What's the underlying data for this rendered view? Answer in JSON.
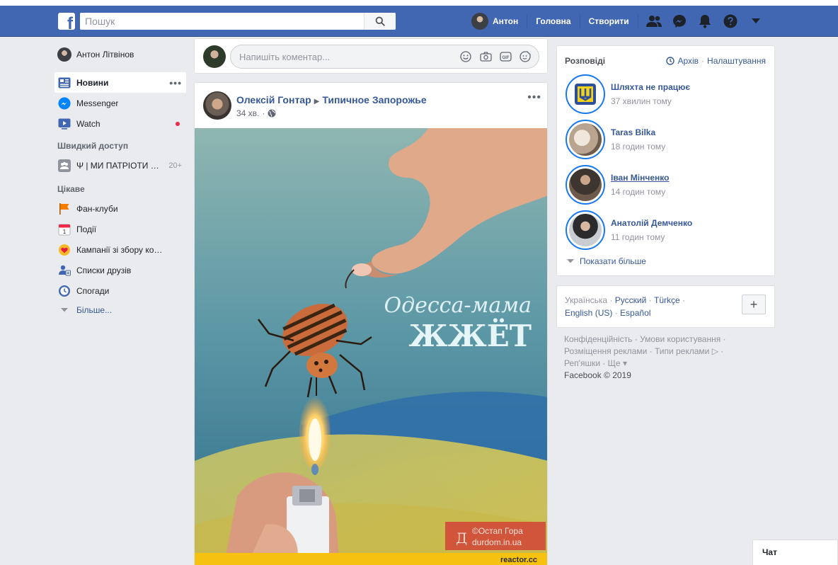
{
  "topbar": {
    "logo_letter": "f",
    "search_placeholder": "Пошук",
    "user_name": "Антон",
    "home_label": "Головна",
    "create_label": "Створити",
    "icons": [
      "friends-icon",
      "messenger-icon",
      "bell-icon",
      "help-icon",
      "caret-down-icon"
    ]
  },
  "sidebar": {
    "profile_name": "Антон Літвінов",
    "main_items": [
      {
        "label": "Новини",
        "icon": "news-feed-icon"
      },
      {
        "label": "Messenger",
        "icon": "messenger-icon"
      },
      {
        "label": "Watch",
        "icon": "watch-icon"
      }
    ],
    "quick_access_title": "Швидкий доступ",
    "quick_access_item": {
      "label": "Ψ | МИ ПАТРІОТИ УКРАЇНИ",
      "count": "20+"
    },
    "explore_title": "Цікаве",
    "explore_items": [
      {
        "label": "Фан-клуби",
        "icon": "flag-icon"
      },
      {
        "label": "Події",
        "icon": "calendar-icon"
      },
      {
        "label": "Кампанії зі збору коштів",
        "icon": "fundraiser-icon"
      },
      {
        "label": "Списки друзів",
        "icon": "friend-lists-icon"
      },
      {
        "label": "Спогади",
        "icon": "memories-icon"
      }
    ],
    "more_label": "Більше..."
  },
  "composer": {
    "placeholder": "Напишіть коментар..."
  },
  "post": {
    "author": "Олексій Гонтар",
    "group": "Типичное Запорожье",
    "time": "34 хв.",
    "image": {
      "caption_line1": "Одесса-мама",
      "caption_line2": "ЖЖЁТ",
      "credit_line1": "©Остап Гора",
      "credit_line2": "durdom.in.ua",
      "watermark": "reactor.cc"
    }
  },
  "stories": {
    "title": "Розповіді",
    "archive_label": "Архів",
    "settings_label": "Налаштування",
    "items": [
      {
        "name": "Шляхта не працює",
        "time": "37 хвилин тому"
      },
      {
        "name": "Taras Bilka",
        "time": "18 годин тому"
      },
      {
        "name": "Іван Мінченко",
        "time": "14 годин тому"
      },
      {
        "name": "Анатолій Демченко",
        "time": "11 годин тому"
      }
    ],
    "show_more_label": "Показати більше"
  },
  "languages": {
    "current": "Українська",
    "others_line1": [
      "Русский",
      "Türkçe"
    ],
    "others_line2": [
      "English (US)",
      "Español"
    ],
    "add_label": "+"
  },
  "footer": {
    "line1": "Конфіденційність · Умови користування ·",
    "line2": "Розміщення реклами · Типи реклами ▷ ·",
    "line3": "Реп'яшки · Ще ▾",
    "copyright": "Facebook © 2019"
  },
  "chat": {
    "label": "Чат"
  },
  "colors": {
    "brand_blue": "#4267b2",
    "link_blue": "#365899",
    "notification_red": "#f02849"
  }
}
